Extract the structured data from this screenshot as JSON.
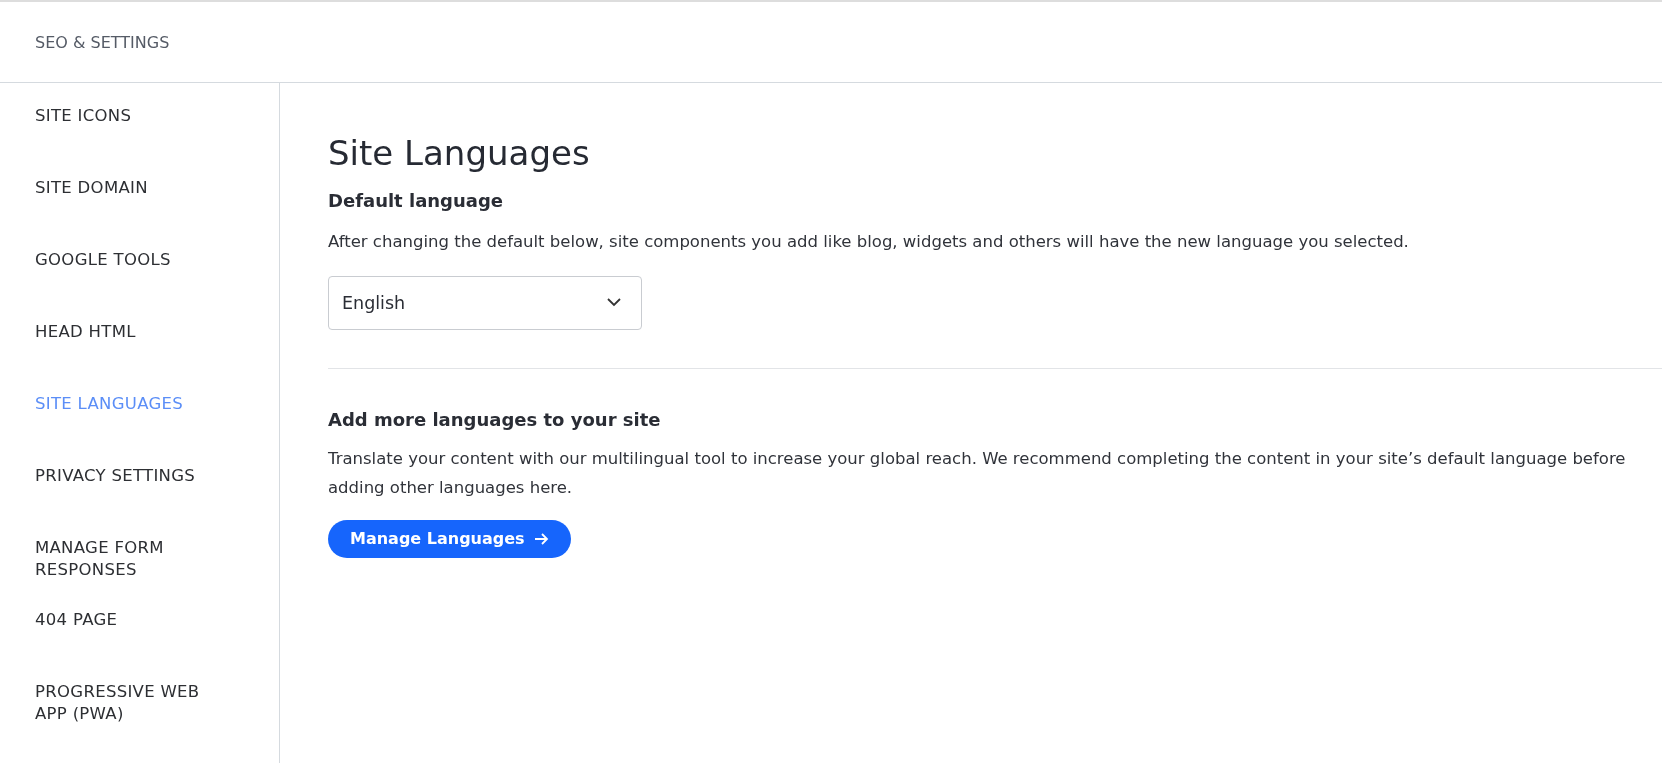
{
  "header": {
    "title": "SEO & SETTINGS"
  },
  "sidebar": {
    "items": [
      {
        "label": "SITE ICONS",
        "selected": false
      },
      {
        "label": "SITE DOMAIN",
        "selected": false
      },
      {
        "label": "GOOGLE TOOLS",
        "selected": false
      },
      {
        "label": "HEAD HTML",
        "selected": false
      },
      {
        "label": "SITE LANGUAGES",
        "selected": true
      },
      {
        "label": "PRIVACY SETTINGS",
        "selected": false
      },
      {
        "label": "MANAGE FORM RESPONSES",
        "selected": false
      },
      {
        "label": "404 PAGE",
        "selected": false
      },
      {
        "label": "PROGRESSIVE WEB APP (PWA)",
        "selected": false
      }
    ]
  },
  "main": {
    "title": "Site Languages",
    "default_language": {
      "heading": "Default language",
      "description": "After changing the default below, site components you add like blog, widgets and others will have the new language you selected.",
      "select": {
        "value": "English"
      }
    },
    "more_languages": {
      "heading": "Add more languages to your site",
      "description": "Translate your content with our multilingual tool to increase your global reach. We recommend completing the content in your site’s default language before adding other languages here.",
      "button": "Manage Languages"
    }
  }
}
